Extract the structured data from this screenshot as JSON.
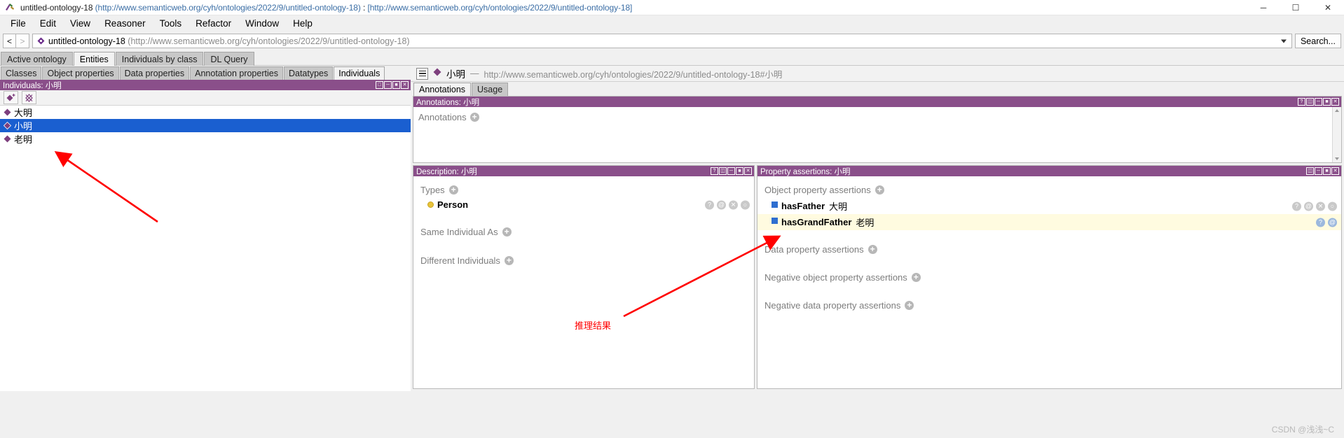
{
  "window": {
    "title_name": "untitled-ontology-18",
    "title_iri": "(http://www.semanticweb.org/cyh/ontologies/2022/9/untitled-ontology-18)",
    "title_sep": " : ",
    "title_path": "[http://www.semanticweb.org/cyh/ontologies/2022/9/untitled-ontology-18]",
    "minimize": "─",
    "maximize": "☐",
    "close": "✕"
  },
  "menubar": {
    "items": [
      "File",
      "Edit",
      "View",
      "Reasoner",
      "Tools",
      "Refactor",
      "Window",
      "Help"
    ]
  },
  "toolbar": {
    "back": "<",
    "forward": ">",
    "ontology_name": "untitled-ontology-18",
    "ontology_iri": "(http://www.semanticweb.org/cyh/ontologies/2022/9/untitled-ontology-18)",
    "search_label": "Search..."
  },
  "main_tabs": [
    {
      "label": "Active ontology",
      "active": false
    },
    {
      "label": "Entities",
      "active": true
    },
    {
      "label": "Individuals by class",
      "active": false
    },
    {
      "label": "DL Query",
      "active": false
    }
  ],
  "entity_tabs": [
    {
      "label": "Classes",
      "active": false
    },
    {
      "label": "Object properties",
      "active": false
    },
    {
      "label": "Data properties",
      "active": false
    },
    {
      "label": "Annotation properties",
      "active": false
    },
    {
      "label": "Datatypes",
      "active": false
    },
    {
      "label": "Individuals",
      "active": true
    }
  ],
  "individuals_panel": {
    "header": "Individuals: 小明",
    "header_buttons": [
      "□",
      "─",
      "■",
      "✕"
    ],
    "toolbar_buttons": [
      "add-individual-icon",
      "delete-individual-icon"
    ],
    "items": [
      {
        "label": "大明",
        "selected": false
      },
      {
        "label": "小明",
        "selected": true
      },
      {
        "label": "老明",
        "selected": false
      }
    ]
  },
  "entity_header": {
    "name": "小明",
    "dash": "—",
    "iri": "http://www.semanticweb.org/cyh/ontologies/2022/9/untitled-ontology-18#小明"
  },
  "annotation_tabs": [
    {
      "label": "Annotations",
      "active": true
    },
    {
      "label": "Usage",
      "active": false
    }
  ],
  "annotations_panel": {
    "header": "Annotations: 小明",
    "header_buttons": [
      "?",
      "◫",
      "─",
      "■",
      "✕"
    ],
    "label": "Annotations"
  },
  "description_panel": {
    "header": "Description: 小明",
    "header_buttons": [
      "?",
      "◫",
      "─",
      "■",
      "✕"
    ],
    "groups": [
      {
        "name": "Types",
        "items": [
          {
            "label": "Person",
            "bullet": "class-dot",
            "actions": [
              "?",
              "@",
              "✕",
              "○"
            ]
          }
        ]
      },
      {
        "name": "Same Individual As",
        "items": []
      },
      {
        "name": "Different Individuals",
        "items": []
      }
    ]
  },
  "property_assertions_panel": {
    "header": "Property assertions: 小明",
    "header_buttons": [
      "◫",
      "─",
      "■",
      "✕"
    ],
    "groups": [
      {
        "name": "Object property assertions",
        "items": [
          {
            "property": "hasFather",
            "value": "大明",
            "highlight": false,
            "actions": [
              "?",
              "@",
              "✕",
              "○"
            ]
          },
          {
            "property": "hasGrandFather",
            "value": "老明",
            "highlight": true,
            "actions": [
              "?",
              "@"
            ]
          }
        ]
      },
      {
        "name": "Data property assertions",
        "items": []
      },
      {
        "name": "Negative object property assertions",
        "items": []
      },
      {
        "name": "Negative data property assertions",
        "items": []
      }
    ]
  },
  "annotations_overlay": {
    "note": "推理结果",
    "arrow_color": "#ff0000"
  },
  "watermark": "CSDN @浅浅~C",
  "colors": {
    "panel_header": "#8a4f8a",
    "selection": "#1a5fd0",
    "highlight_row": "#fffbe0",
    "accent_red": "#ff0000"
  }
}
